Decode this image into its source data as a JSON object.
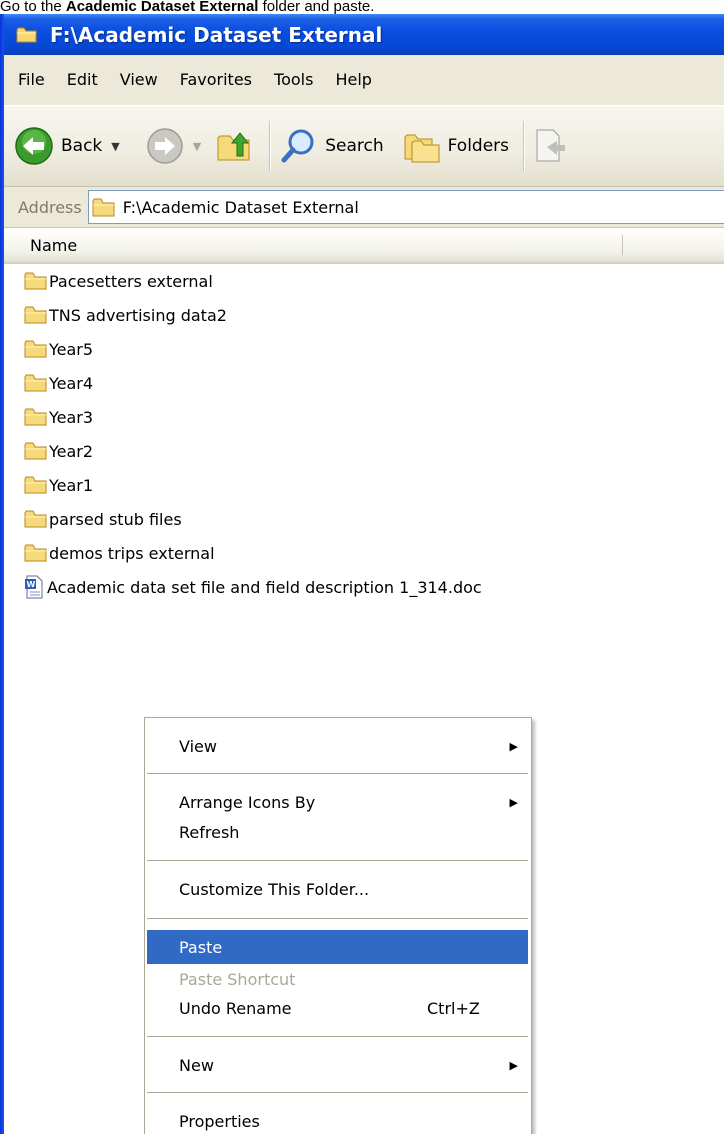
{
  "caption": {
    "prefix": "Go to the ",
    "bold": "Academic Dataset External",
    "suffix": " folder and paste."
  },
  "window": {
    "title": "F:\\Academic Dataset External"
  },
  "menubar": {
    "items": [
      "File",
      "Edit",
      "View",
      "Favorites",
      "Tools",
      "Help"
    ]
  },
  "toolbar": {
    "back_label": "Back",
    "search_label": "Search",
    "folders_label": "Folders"
  },
  "address": {
    "label": "Address",
    "value": "F:\\Academic Dataset External"
  },
  "list": {
    "column_name": "Name",
    "items": [
      {
        "name": "Pacesetters external",
        "type": "folder"
      },
      {
        "name": "TNS advertising data2",
        "type": "folder"
      },
      {
        "name": "Year5",
        "type": "folder"
      },
      {
        "name": "Year4",
        "type": "folder"
      },
      {
        "name": "Year3",
        "type": "folder"
      },
      {
        "name": "Year2",
        "type": "folder"
      },
      {
        "name": "Year1",
        "type": "folder"
      },
      {
        "name": "parsed stub files",
        "type": "folder"
      },
      {
        "name": "demos trips external",
        "type": "folder"
      },
      {
        "name": "Academic data set file and field description 1_314.doc",
        "type": "doc"
      }
    ]
  },
  "context_menu": {
    "view": "View",
    "arrange": "Arrange Icons By",
    "refresh": "Refresh",
    "customize": "Customize This Folder...",
    "paste": "Paste",
    "paste_shortcut": "Paste Shortcut",
    "undo_rename": "Undo Rename",
    "undo_shortcut": "Ctrl+Z",
    "new": "New",
    "properties": "Properties"
  },
  "colors": {
    "titlebar": "#0548d6",
    "selection": "#316ac5",
    "chrome": "#ece9d8",
    "folder": "#f5d97a"
  },
  "icons": [
    "folder-icon",
    "back-arrow-icon",
    "forward-arrow-icon",
    "up-folder-icon",
    "search-magnifier-icon",
    "folders-icon",
    "word-doc-icon",
    "submenu-arrow-icon"
  ]
}
